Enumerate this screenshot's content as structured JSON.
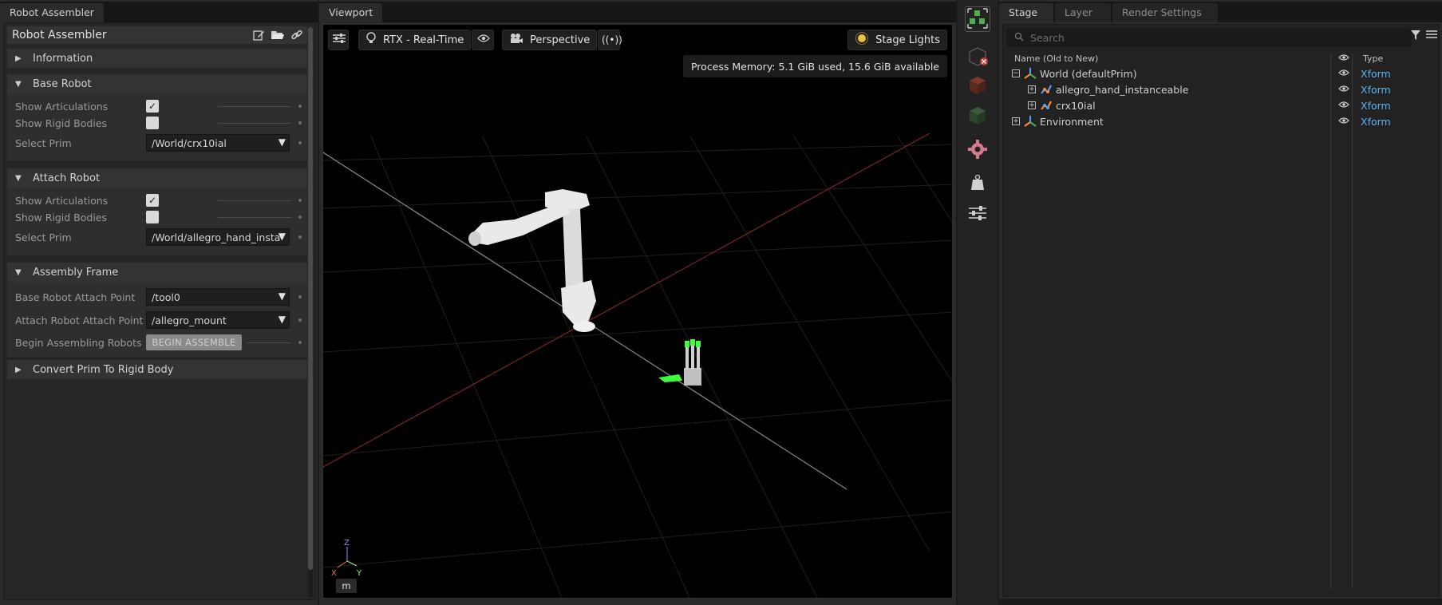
{
  "left_panel": {
    "tab_label": "Robot Assembler",
    "title": "Robot Assembler",
    "title_icons": [
      "edit-icon",
      "folder-open-icon",
      "link-icon"
    ],
    "sections": {
      "information": {
        "label": "Information"
      },
      "base_robot": {
        "label": "Base Robot",
        "show_articulations_label": "Show Articulations",
        "show_articulations_checked": true,
        "show_rigid_bodies_label": "Show Rigid Bodies",
        "show_rigid_bodies_checked": false,
        "select_prim_label": "Select Prim",
        "select_prim_value": "/World/crx10ial"
      },
      "attach_robot": {
        "label": "Attach Robot",
        "show_articulations_label": "Show Articulations",
        "show_articulations_checked": true,
        "show_rigid_bodies_label": "Show Rigid Bodies",
        "show_rigid_bodies_checked": false,
        "select_prim_label": "Select Prim",
        "select_prim_value": "/World/allegro_hand_insta"
      },
      "assembly_frame": {
        "label": "Assembly Frame",
        "base_attach_label": "Base Robot Attach Point",
        "base_attach_value": "/tool0",
        "attach_attach_label": "Attach Robot Attach Point",
        "attach_attach_value": "/allegro_mount",
        "begin_label": "Begin Assembling Robots",
        "begin_button": "BEGIN ASSEMBLE"
      },
      "convert": {
        "label": "Convert Prim To Rigid Body"
      }
    }
  },
  "viewport": {
    "tab_label": "Viewport",
    "render_mode": "RTX - Real-Time",
    "camera": "Perspective",
    "stage_lights": "Stage Lights",
    "memory": "Process Memory: 5.1 GiB used, 15.6 GiB available",
    "units": "m",
    "axis_labels": {
      "x": "X",
      "y": "Y",
      "z": "Z"
    }
  },
  "stage_panel": {
    "tabs": [
      "Stage",
      "Layer",
      "Render Settings"
    ],
    "search_placeholder": "Search",
    "col_name": "Name (Old to New)",
    "col_type": "Type",
    "rows": [
      {
        "name": "World (defaultPrim)",
        "type": "Xform",
        "expander": "−",
        "icon": "xform-icon"
      },
      {
        "name": "allegro_hand_instanceable",
        "type": "Xform",
        "expander": "+",
        "icon": "articulation-icon"
      },
      {
        "name": "crx10ial",
        "type": "Xform",
        "expander": "+",
        "icon": "articulation-icon"
      },
      {
        "name": "Environment",
        "type": "Xform",
        "expander": "+",
        "icon": "xform-icon"
      }
    ]
  },
  "colors": {
    "accent_type": "#5eb3f0",
    "grid_red": "#8a2a2a",
    "tool_active_pink": "#d47a8a",
    "green_fingers": "#3cff3c"
  }
}
